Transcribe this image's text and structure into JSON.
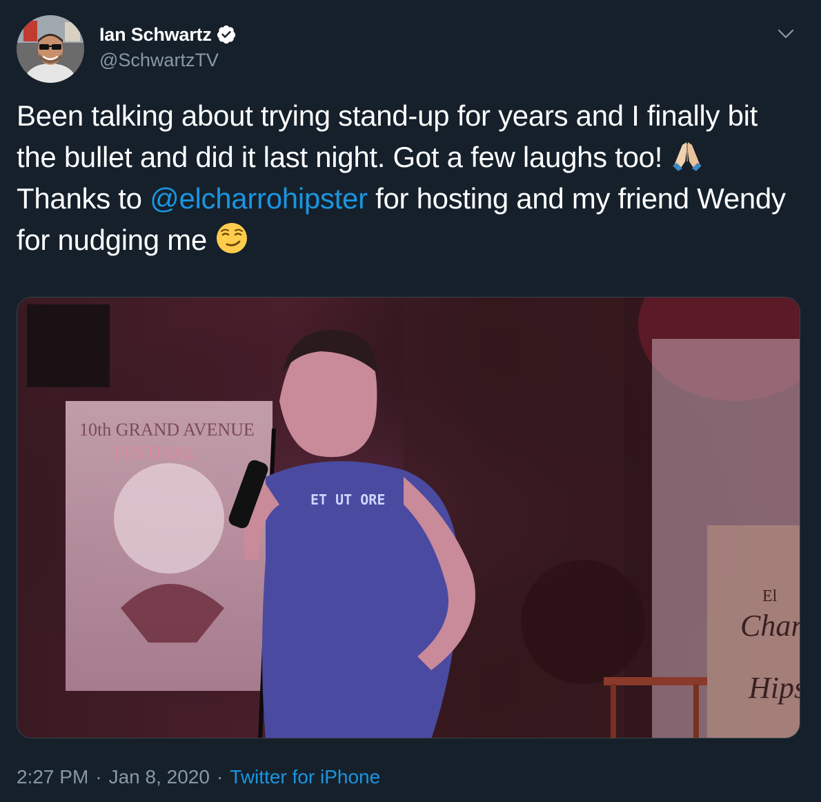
{
  "author": {
    "display_name": "Ian Schwartz",
    "handle": "@SchwartzTV",
    "verified_icon": "verified-badge-icon"
  },
  "tweet": {
    "text_part1": "Been talking about trying stand-up for years and I finally bit the bullet and did it last night. Got a few laughs too! ",
    "emoji_1": "folded-hands-emoji",
    "text_part2": " Thanks to ",
    "mention": "@elcharrohipster",
    "text_part3": " for hosting and my friend Wendy for nudging me ",
    "emoji_2": "smirking-face-emoji"
  },
  "media": {
    "poster_text_1": "10th GRAND AVENUE",
    "poster_text_2": "FESTIVAL",
    "shirt_text": "ET UT ORE",
    "sign_text_1": "El",
    "sign_text_2": "Char",
    "sign_text_3": "Hips"
  },
  "meta": {
    "time": "2:27 PM",
    "separator": "·",
    "date": "Jan 8, 2020",
    "source": "Twitter for iPhone"
  },
  "colors": {
    "background": "#15202b",
    "secondary_text": "#8899a6",
    "link": "#1b95e0"
  }
}
